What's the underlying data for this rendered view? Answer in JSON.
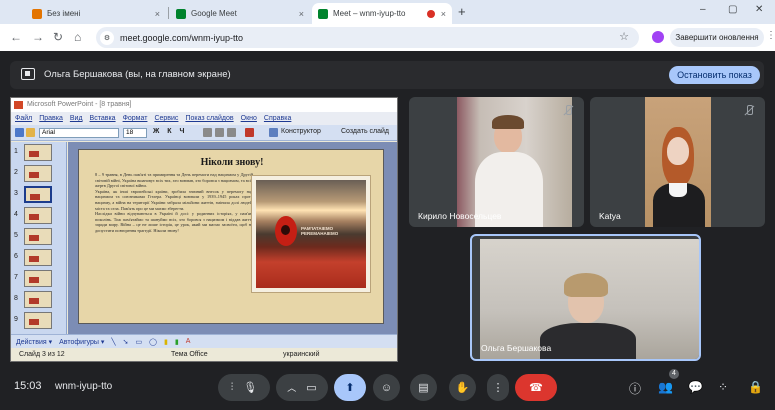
{
  "browser": {
    "tabs": [
      {
        "title": "Без імені",
        "close": "×"
      },
      {
        "title": "Google Meet",
        "close": "×"
      },
      {
        "title": "Meet – wnm-iyup-tto",
        "close": "×"
      }
    ],
    "new_tab": "+",
    "window_controls": [
      "–",
      "▢",
      "✕"
    ],
    "url": "meet.google.com/wnm-iyup-tto",
    "update_button": "Завершити оновлення",
    "menu": "⋮"
  },
  "presentation_bar": {
    "text": "Ольга Бершакова (вы, на главном экране)",
    "stop_button": "Остановить показ"
  },
  "powerpoint": {
    "title": "Microsoft PowerPoint - [8 травня]",
    "menu": [
      "Файл",
      "Правка",
      "Вид",
      "Вставка",
      "Формат",
      "Сервис",
      "Показ слайдов",
      "Окно",
      "Справка"
    ],
    "font": "Arial",
    "font_size": "18",
    "format_buttons": "Ж К Ч",
    "constructor_button": "Конструктор",
    "new_slide_button": "Создать слайд",
    "thumbnails": [
      "1",
      "2",
      "3",
      "4",
      "5",
      "6",
      "7",
      "8",
      "9"
    ],
    "slide": {
      "title": "Ніколи знову!",
      "paragraphs": [
        "8 – 9 травня, в День пам'яті та примирення та День перемоги над нацизмом у Другій світовій війні, Україна вшановує всіх тих, хто воював, хто боровся з нацизмом, та всіх жертв Другої світової війни.",
        "Україна, як інші європейські країни, зробила значний внесок у перемогу над нацизмом та союзниками Гітлера. Українці воювали у 1939–1945 роках проти нацизму, а війна на території України забрала мільйони життів, змінила долі людей, міста та села. Пам'ять про це ми маємо зберегти.",
        "Наслідки війни відчуваються в Україні й досі: у родинних історіях, у пам'яті поколінь. Тож пам'ятаймо та шануймо всіх, хто боровся з нацизмом і віддав життя заради миру. Війна – це не лише історія, це урок, який ми маємо засвоїти, щоб не допустити повторення трагедії. Ніколи знову!"
      ],
      "photo_caption": "PAM'IATAIEMO\nPEREMAHAIEMO"
    },
    "draw_toolbar": [
      "Действия ▾",
      "Автофигуры ▾"
    ],
    "status": [
      "Слайд 3 из 12",
      "Тема Office",
      "украинский"
    ]
  },
  "participants": [
    {
      "name": "Кирило Новосельцев",
      "muted": true
    },
    {
      "name": "Katya",
      "muted": true
    },
    {
      "name": "Ольга Бершакова",
      "muted": false
    }
  ],
  "bottom": {
    "time": "15:03",
    "meeting_code": "wnm-iyup-tto",
    "people_count": "4"
  }
}
